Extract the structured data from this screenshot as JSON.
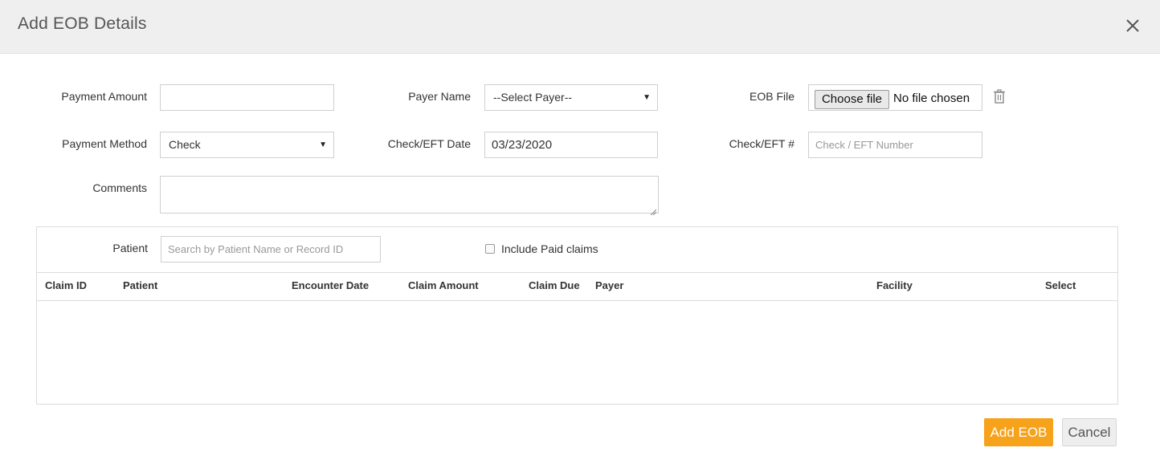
{
  "modal": {
    "title": "Add EOB Details",
    "close_icon": "close-icon"
  },
  "form": {
    "payment_amount": {
      "label": "Payment Amount",
      "value": ""
    },
    "payer_name": {
      "label": "Payer Name",
      "selected": "--Select Payer--"
    },
    "eob_file": {
      "label": "EOB File",
      "button": "Choose file",
      "status": "No file chosen",
      "delete_icon": "trash-icon"
    },
    "payment_method": {
      "label": "Payment Method",
      "selected": "Check"
    },
    "check_date": {
      "label": "Check/EFT Date",
      "value": "03/23/2020"
    },
    "check_number": {
      "label": "Check/EFT #",
      "placeholder": "Check / EFT Number"
    },
    "comments": {
      "label": "Comments",
      "value": ""
    }
  },
  "claims_panel": {
    "patient_label": "Patient",
    "patient_search_placeholder": "Search by Patient Name or Record ID",
    "include_paid_label": "Include Paid claims",
    "include_paid_checked": false,
    "columns": [
      "Claim ID",
      "Patient",
      "Encounter Date",
      "Claim Amount",
      "Claim Due",
      "Payer",
      "Facility",
      "Select"
    ],
    "rows": []
  },
  "actions": {
    "primary": "Add EOB",
    "secondary": "Cancel"
  },
  "colors": {
    "header_bg": "#efefef",
    "primary_button": "#f7a21b",
    "border": "#cfcfcf"
  }
}
